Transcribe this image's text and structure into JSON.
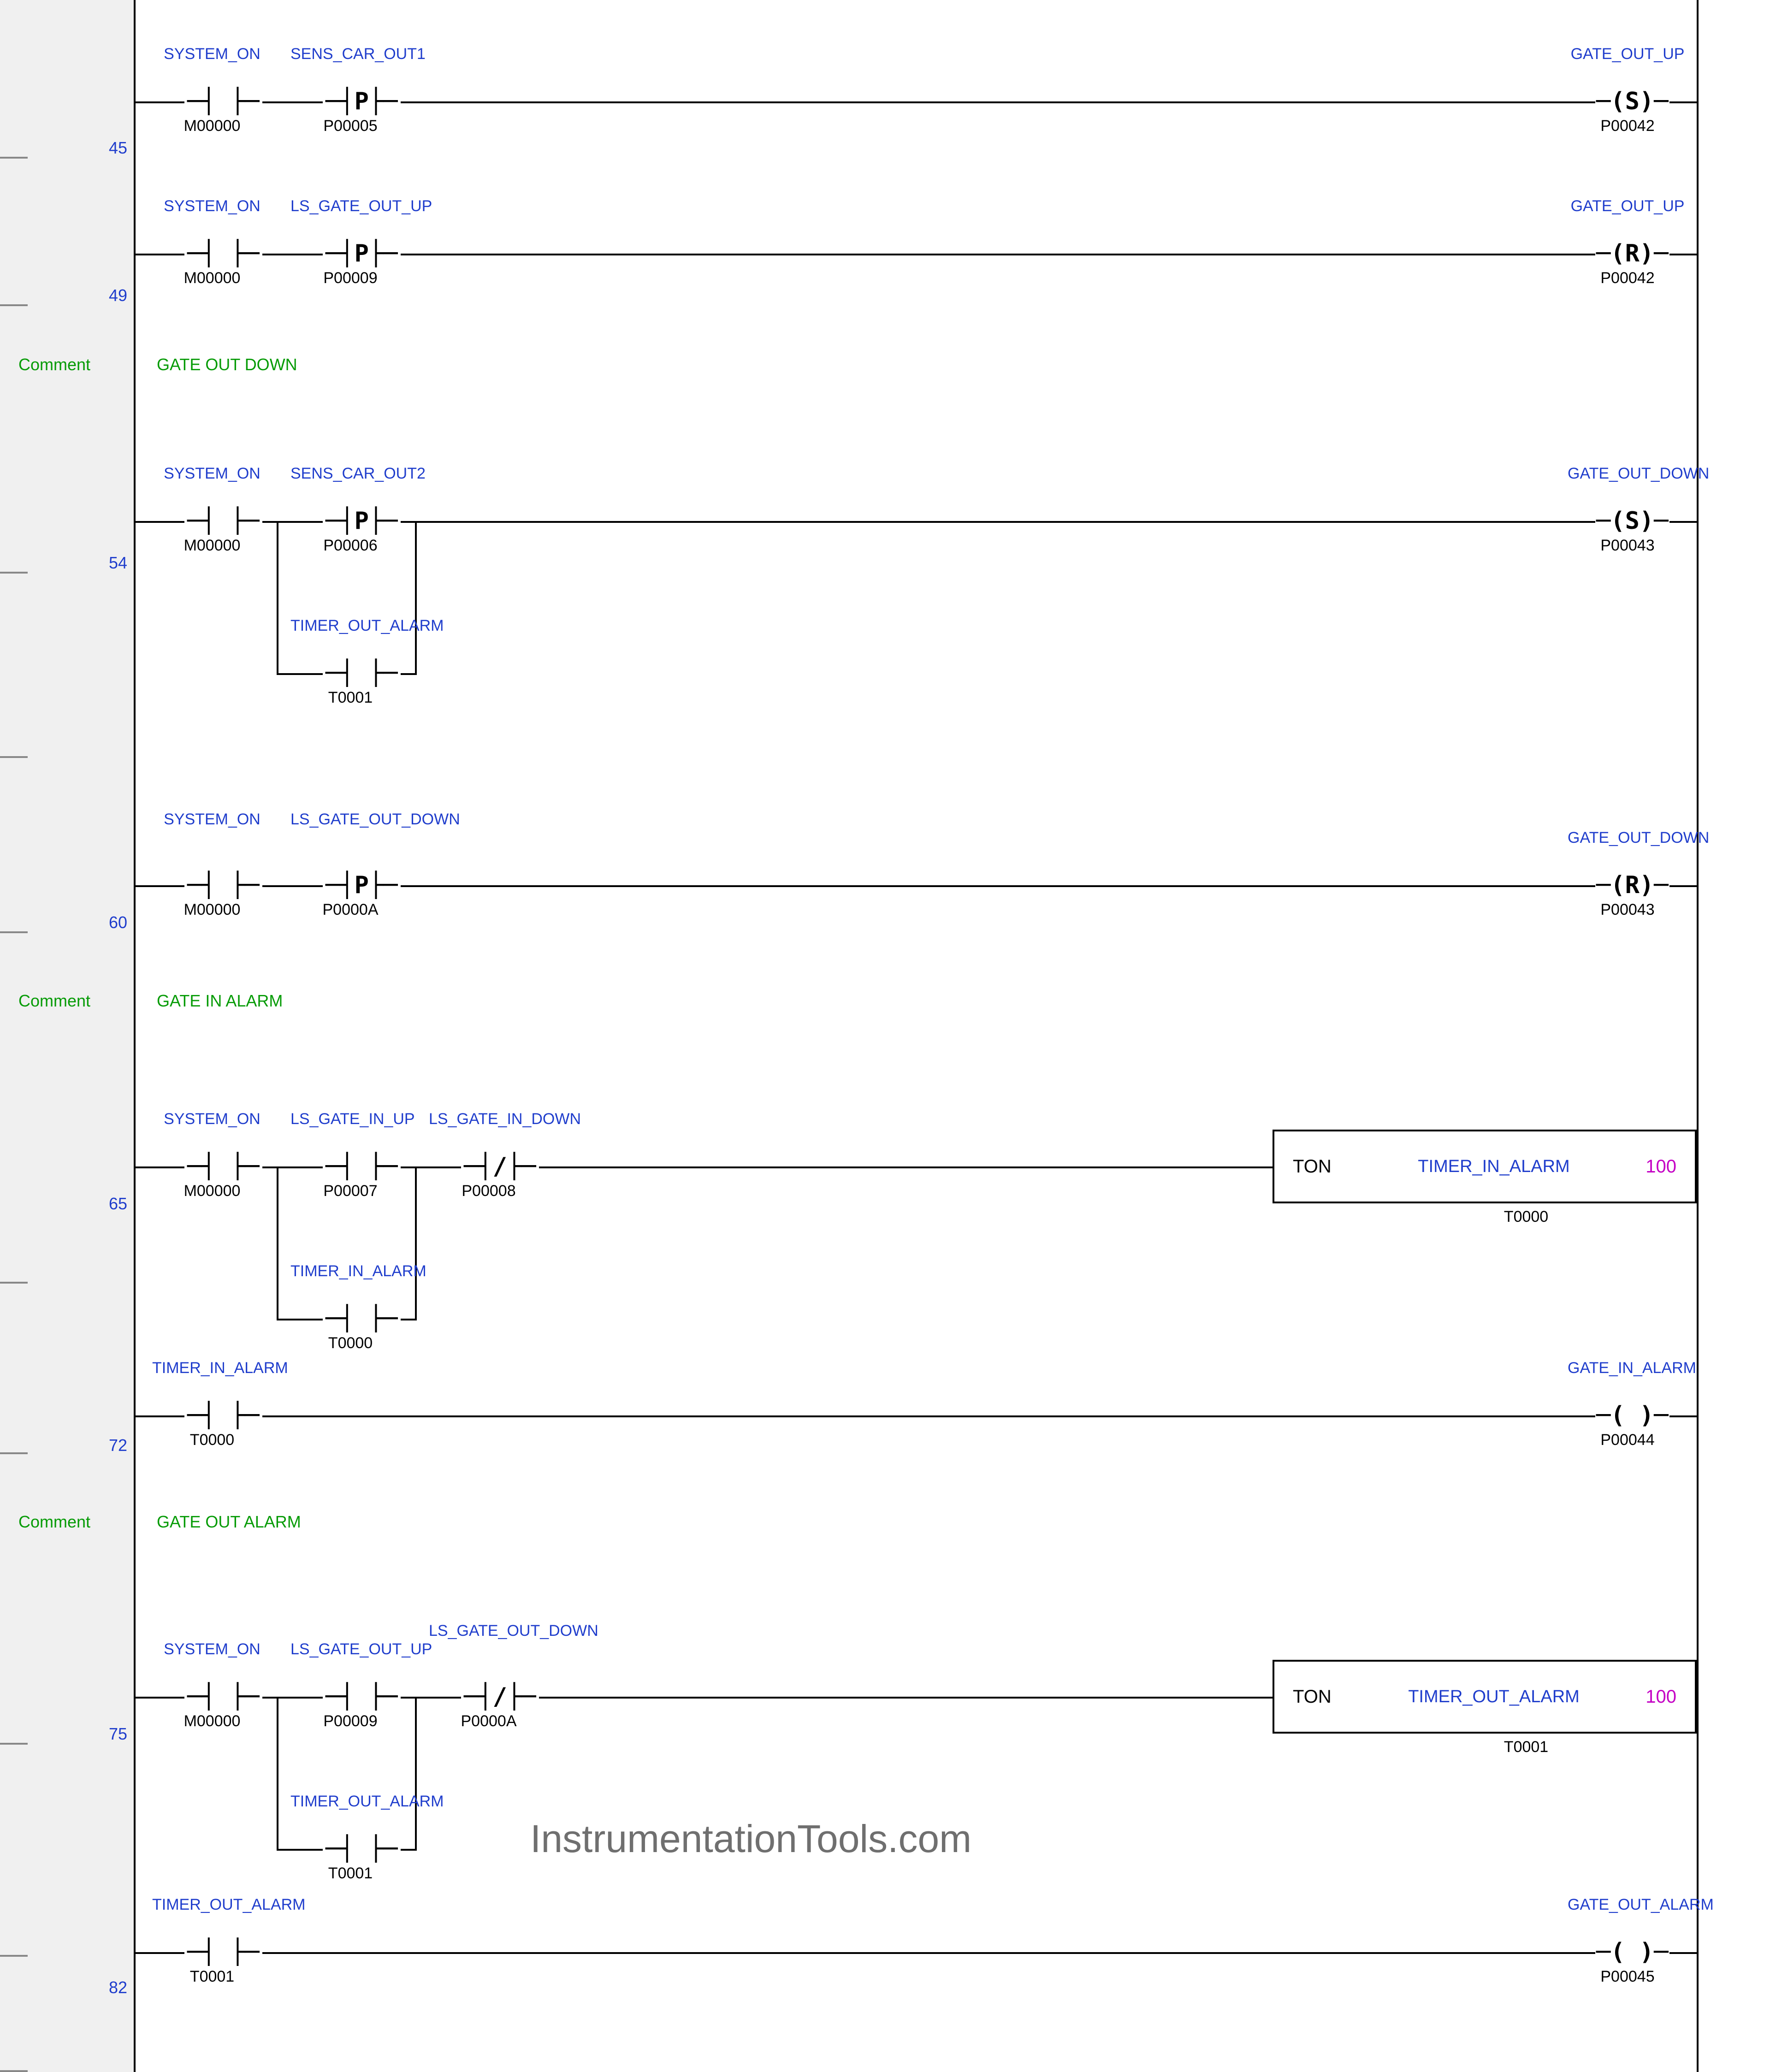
{
  "rung_nums": {
    "r45": "45",
    "r49": "49",
    "r54": "54",
    "r60": "60",
    "r65": "65",
    "r72": "72",
    "r75": "75",
    "r82": "82"
  },
  "comments": {
    "label": "Comment",
    "c1": "GATE OUT DOWN",
    "c2": "GATE IN ALARM",
    "c3": "GATE OUT ALARM"
  },
  "tags": {
    "system_on": "SYSTEM_ON",
    "sens_car_out1": "SENS_CAR_OUT1",
    "sens_car_out2": "SENS_CAR_OUT2",
    "ls_gate_out_up": "LS_GATE_OUT_UP",
    "ls_gate_out_down": "LS_GATE_OUT_DOWN",
    "ls_gate_in_up": "LS_GATE_IN_UP",
    "ls_gate_in_down": "LS_GATE_IN_DOWN",
    "timer_in_alarm": "TIMER_IN_ALARM",
    "timer_out_alarm": "TIMER_OUT_ALARM",
    "gate_out_up": "GATE_OUT_UP",
    "gate_out_down": "GATE_OUT_DOWN",
    "gate_in_alarm": "GATE_IN_ALARM",
    "gate_out_alarm": "GATE_OUT_ALARM"
  },
  "addrs": {
    "m00000": "M00000",
    "p00005": "P00005",
    "p00006": "P00006",
    "p00007": "P00007",
    "p00008": "P00008",
    "p00009": "P00009",
    "p0000a": "P0000A",
    "p00042": "P00042",
    "p00043": "P00043",
    "p00044": "P00044",
    "p00045": "P00045",
    "t0000": "T0000",
    "t0001": "T0001"
  },
  "ton": {
    "label": "TON",
    "pv": "100"
  },
  "watermark": "InstrumentationTools.com"
}
